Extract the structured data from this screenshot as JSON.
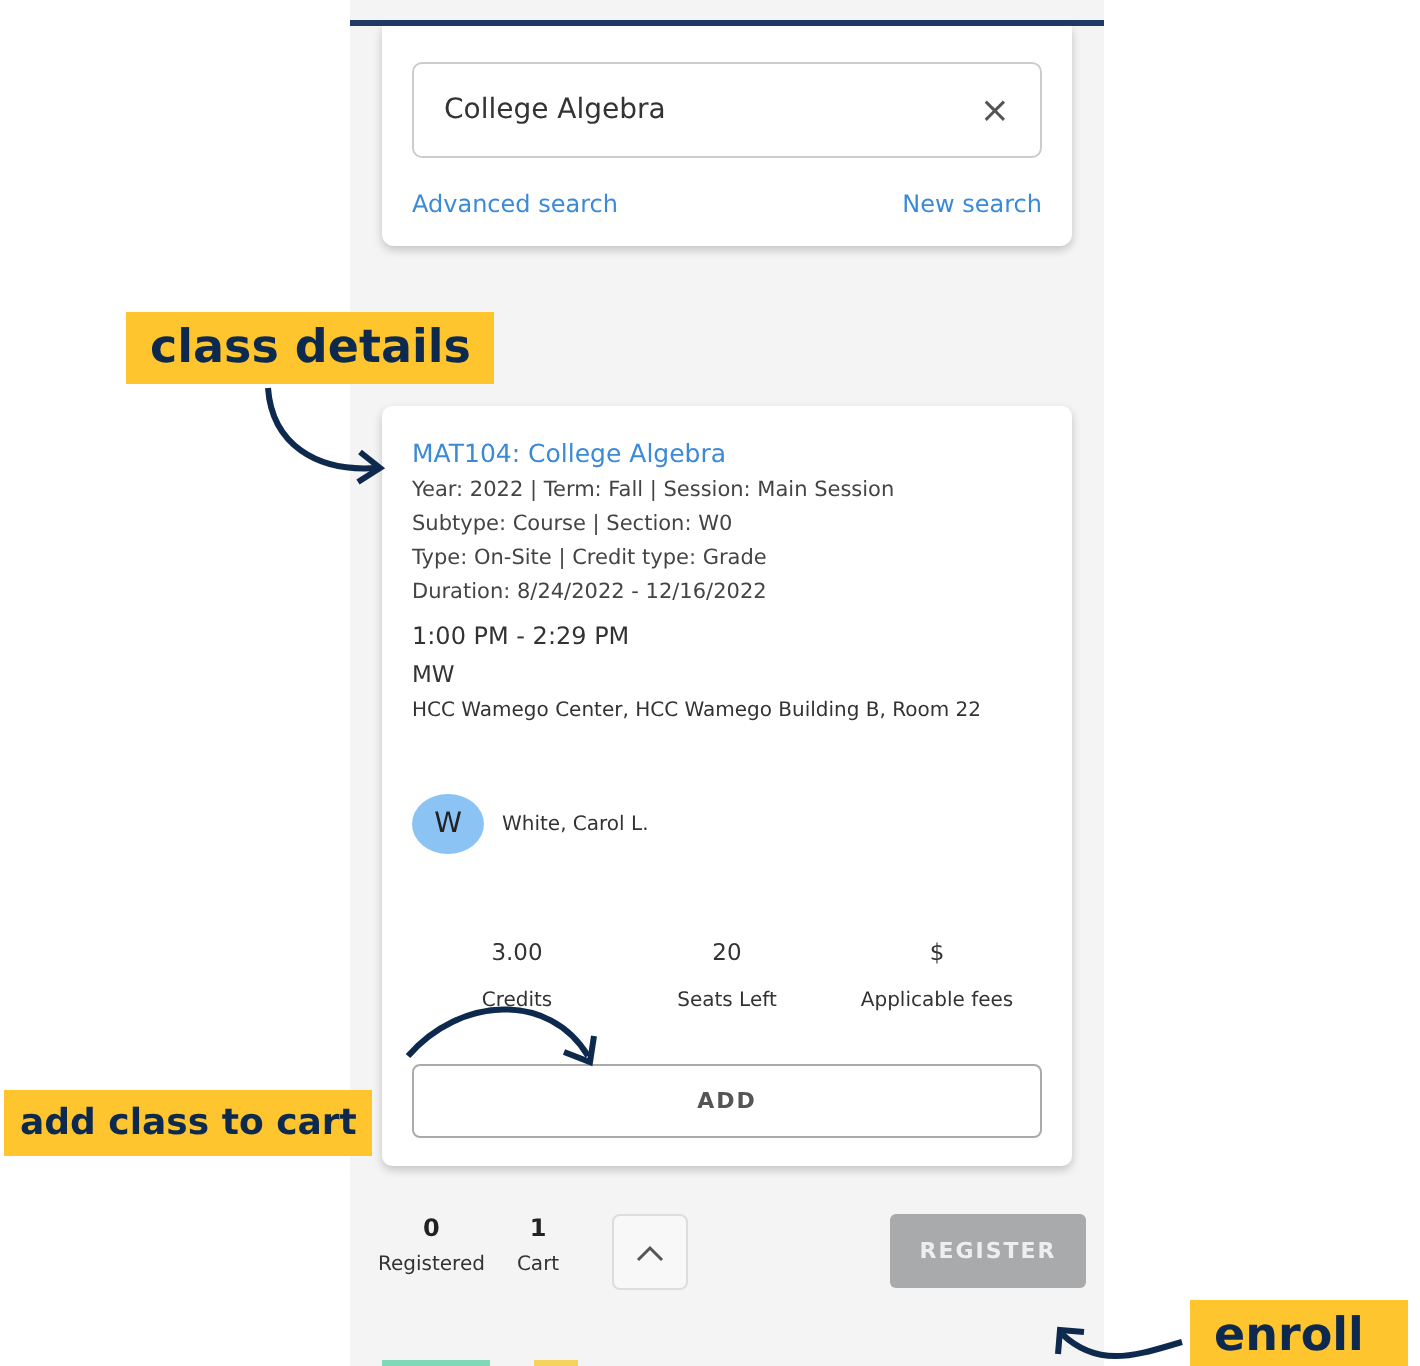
{
  "search": {
    "value": "College Algebra",
    "clear_icon": "×",
    "links": [
      "Advanced search",
      "New search"
    ]
  },
  "course": {
    "title": "MAT104: College Algebra",
    "details": [
      "Year: 2022 | Term: Fall | Session: Main Session",
      "Subtype: Course | Section: W0",
      "Type: On-Site | Credit type: Grade",
      "Duration: 8/24/2022 - 12/16/2022"
    ],
    "time": "1:00 PM - 2:29 PM",
    "days": "MW",
    "location": "HCC Wamego Center, HCC Wamego Building B, Room 22",
    "instructor": {
      "initial": "W",
      "name": "White, Carol L."
    },
    "stats": [
      {
        "value": "3.00",
        "label": "Credits"
      },
      {
        "value": "20",
        "label": "Seats Left"
      },
      {
        "value": "$",
        "label": "Applicable fees"
      }
    ],
    "add_button": "ADD"
  },
  "footer": {
    "counts": [
      {
        "value": "0",
        "label": "Registered"
      },
      {
        "value": "1",
        "label": "Cart"
      }
    ],
    "register_button": {
      "label": "REGISTER",
      "disabled": true
    }
  },
  "annotations": [
    {
      "kind": "details",
      "text": "class details"
    },
    {
      "kind": "add",
      "text": "add class to cart"
    },
    {
      "kind": "enroll",
      "text": "enroll"
    }
  ]
}
